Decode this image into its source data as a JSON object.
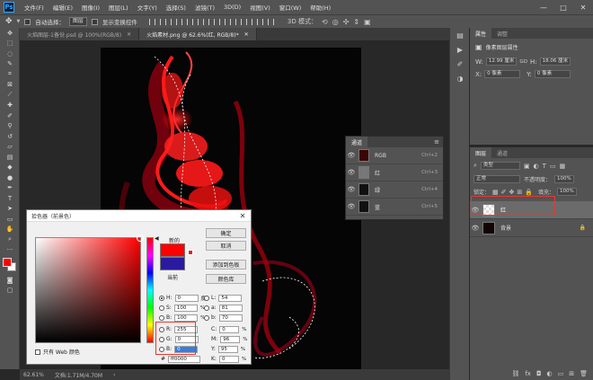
{
  "menubar": {
    "logo": "Ps",
    "items": [
      "文件(F)",
      "编辑(E)",
      "图像(I)",
      "图层(L)",
      "文字(Y)",
      "选择(S)",
      "滤镜(T)",
      "3D(D)",
      "视图(V)",
      "窗口(W)",
      "帮助(H)"
    ],
    "window_controls": [
      "—",
      "□",
      "✕"
    ]
  },
  "options": {
    "auto_select_label": "自动选择：",
    "auto_select_value": "图层",
    "transform_label": "显示变换控件"
  },
  "tabs": [
    {
      "label": "火焰图层-1备份.psd @ 100%(RGB/8)",
      "active": false
    },
    {
      "label": "火焰素材.png @ 62.6%(红, RGB/8)*",
      "active": true
    }
  ],
  "status": {
    "zoom": "62.61%",
    "doc": "文档:1.71M/4.70M"
  },
  "properties": {
    "tabs": [
      "属性",
      "调整"
    ],
    "title": "像素图层属性",
    "w_label": "W:",
    "w_value": "12.99 厘米",
    "link_icon": "GO",
    "h_label": "H:",
    "h_value": "18.06 厘米",
    "x_label": "X:",
    "x_value": "0 像素",
    "y_label": "Y:",
    "y_value": "0 像素"
  },
  "layers": {
    "tabs": [
      "图层",
      "通道"
    ],
    "kind_filter": "类型",
    "blend_mode": "正常",
    "opacity_label": "不透明度：",
    "opacity_value": "100%",
    "lock_label": "锁定：",
    "fill_label": "填充：",
    "fill_value": "100%",
    "rows": [
      {
        "name": "红",
        "selected": true
      },
      {
        "name": "背景",
        "selected": false
      }
    ]
  },
  "channels": {
    "title": "通道",
    "rows": [
      {
        "name": "RGB",
        "key": "Ctrl+2"
      },
      {
        "name": "红",
        "key": "Ctrl+3"
      },
      {
        "name": "绿",
        "key": "Ctrl+4"
      },
      {
        "name": "蓝",
        "key": "Ctrl+5"
      }
    ]
  },
  "picker": {
    "title": "拾色器（前景色）",
    "new_label": "新的",
    "current_label": "当前",
    "buttons": [
      "确定",
      "取消",
      "添加到色板",
      "颜色库"
    ],
    "web_only_label": "只有 Web 颜色",
    "hsb": [
      {
        "label": "H:",
        "value": "0",
        "unit": "度"
      },
      {
        "label": "S:",
        "value": "100",
        "unit": "%"
      },
      {
        "label": "B:",
        "value": "100",
        "unit": "%"
      }
    ],
    "rgb": [
      {
        "label": "R:",
        "value": "255"
      },
      {
        "label": "G:",
        "value": "0"
      },
      {
        "label": "B:",
        "value": "0"
      }
    ],
    "lab": [
      {
        "label": "L:",
        "value": "54"
      },
      {
        "label": "a:",
        "value": "81"
      },
      {
        "label": "b:",
        "value": "70"
      }
    ],
    "cmyk": [
      {
        "label": "C:",
        "value": "0",
        "unit": "%"
      },
      {
        "label": "M:",
        "value": "96",
        "unit": "%"
      },
      {
        "label": "Y:",
        "value": "95",
        "unit": "%"
      },
      {
        "label": "K:",
        "value": "0",
        "unit": "%"
      }
    ],
    "hex_label": "#",
    "hex_value": "ff0000",
    "new_color": "#ff0000",
    "current_color": "#2a1aa0"
  },
  "colors": {
    "ui_dark": "#535353",
    "highlight_red": "#e53935",
    "fire_red": "#ff1a1a"
  }
}
